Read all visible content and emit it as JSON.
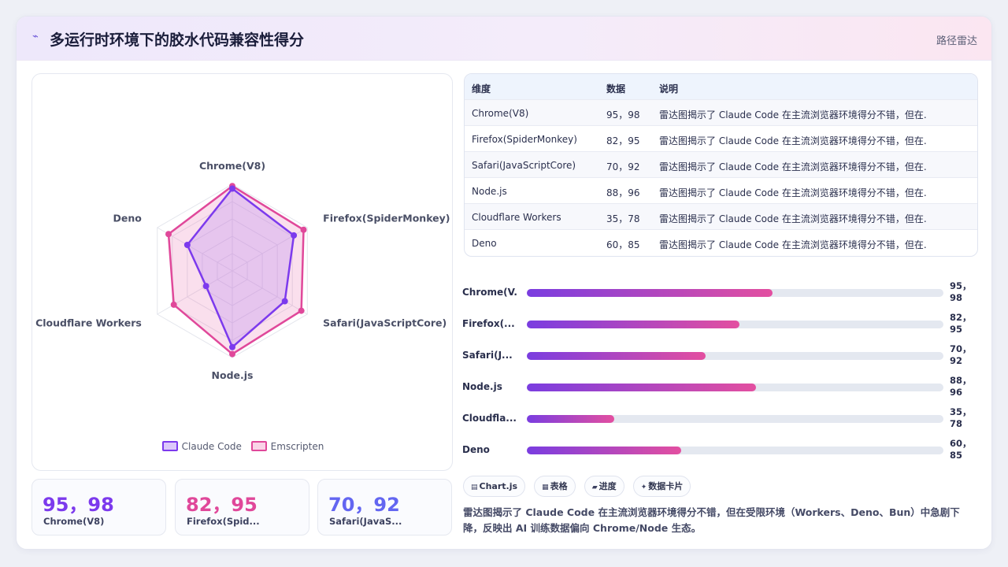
{
  "header": {
    "logo_icon": "lightning-icon",
    "title": "多运行时环境下的胶水代码兼容性得分",
    "tag": "路径雷达"
  },
  "chart_data": {
    "type": "radar",
    "categories": [
      "Chrome(V8)",
      "Firefox(SpiderMonkey)",
      "Safari(JavaScriptCore)",
      "Node.js",
      "Cloudflare Workers",
      "Deno"
    ],
    "series": [
      {
        "name": "Claude Code",
        "values": [
          95,
          82,
          70,
          88,
          35,
          60
        ],
        "color": "#7c3aed"
      },
      {
        "name": "Emscripten",
        "values": [
          98,
          95,
          92,
          96,
          78,
          85
        ],
        "color": "#e0489a"
      }
    ],
    "range": [
      0,
      100
    ],
    "grid_levels": 5
  },
  "kpis": [
    {
      "value": "95，98",
      "label": "Chrome(V8)",
      "color": "#7c3aed"
    },
    {
      "value": "82，95",
      "label": "Firefox(Spid...",
      "color": "#e0489a"
    },
    {
      "value": "70，92",
      "label": "Safari(JavaS...",
      "color": "#6366f1"
    }
  ],
  "table": {
    "headers": [
      "维度",
      "数据",
      "说明"
    ],
    "rows": [
      [
        "Chrome(V8)",
        "95，98",
        "雷达图揭示了 Claude Code 在主流浏览器环境得分不错，但在..."
      ],
      [
        "Firefox(SpiderMonkey)",
        "82，95",
        "雷达图揭示了 Claude Code 在主流浏览器环境得分不错，但在..."
      ],
      [
        "Safari(JavaScriptCore)",
        "70，92",
        "雷达图揭示了 Claude Code 在主流浏览器环境得分不错，但在..."
      ],
      [
        "Node.js",
        "88，96",
        "雷达图揭示了 Claude Code 在主流浏览器环境得分不错，但在..."
      ],
      [
        "Cloudflare Workers",
        "35，78",
        "雷达图揭示了 Claude Code 在主流浏览器环境得分不错，但在..."
      ],
      [
        "Deno",
        "60，85",
        "雷达图揭示了 Claude Code 在主流浏览器环境得分不错，但在..."
      ]
    ]
  },
  "progress": [
    {
      "label": "Chrome(V...",
      "value_line1": "95，",
      "value_line2": "98",
      "fraction": 0.59
    },
    {
      "label": "Firefox(...",
      "value_line1": "82，",
      "value_line2": "95",
      "fraction": 0.51
    },
    {
      "label": "Safari(J...",
      "value_line1": "70，",
      "value_line2": "92",
      "fraction": 0.43
    },
    {
      "label": "Node.js",
      "value_line1": "88，",
      "value_line2": "96",
      "fraction": 0.55
    },
    {
      "label": "Cloudfla...",
      "value_line1": "35，",
      "value_line2": "78",
      "fraction": 0.21
    },
    {
      "label": "Deno",
      "value_line1": "60，",
      "value_line2": "85",
      "fraction": 0.37
    }
  ],
  "chips": [
    {
      "icon": "chart-icon",
      "label": "Chart.js"
    },
    {
      "icon": "table-icon",
      "label": "表格"
    },
    {
      "icon": "progress-icon",
      "label": "进度"
    },
    {
      "icon": "card-icon",
      "label": "数据卡片"
    }
  ],
  "description": "雷达图揭示了 Claude Code 在主流浏览器环境得分不错，但在受限环境（Workers、Deno、Bun）中急剧下降，反映出 AI 训练数据偏向 Chrome/Node 生态。"
}
